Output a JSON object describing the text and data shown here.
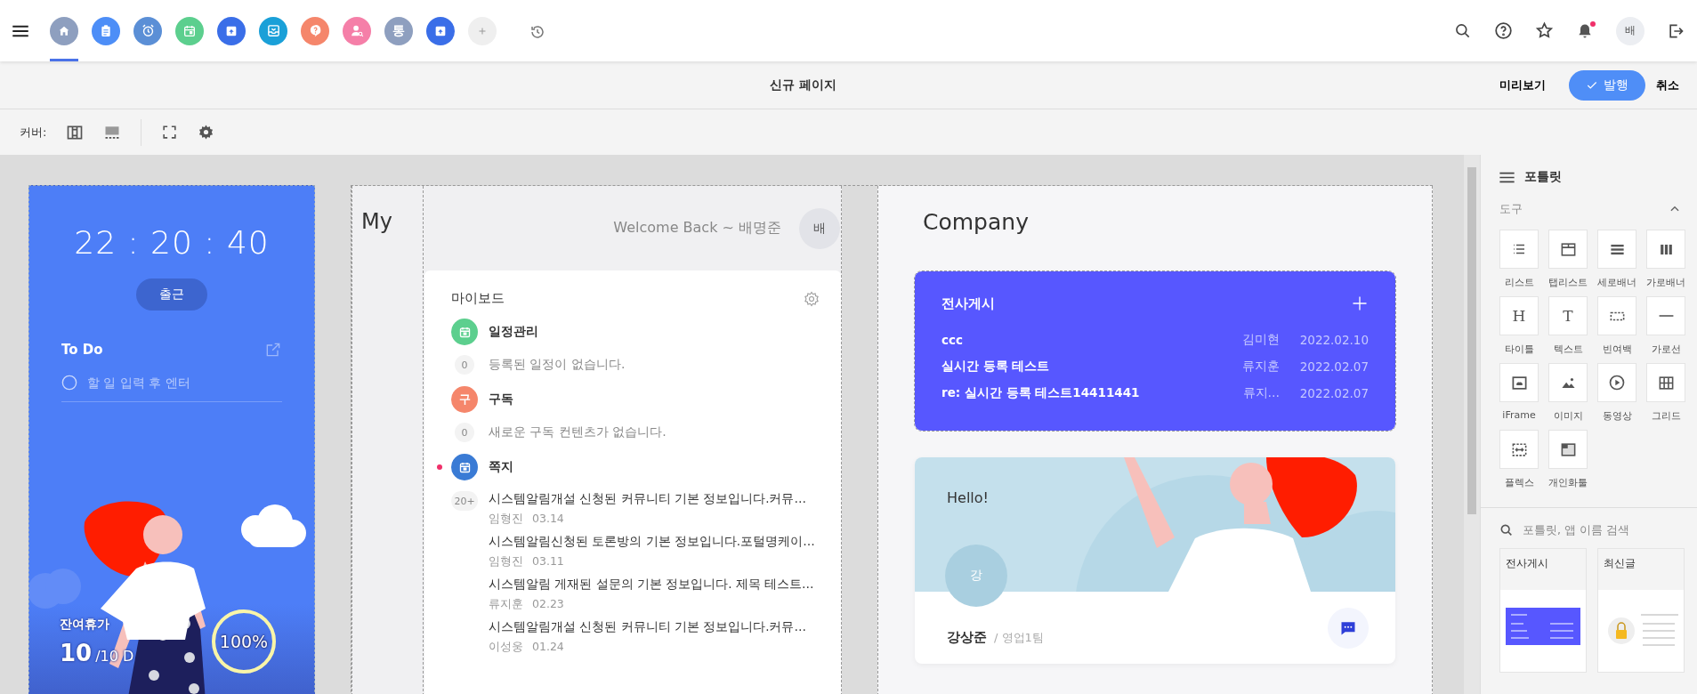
{
  "header": {
    "apps": [
      {
        "kind": "home",
        "color": "#8e9fbf",
        "selected": true
      },
      {
        "kind": "clipboard",
        "color": "#4d8ef7",
        "selected": false
      },
      {
        "kind": "alarm",
        "color": "#5b8fd6",
        "selected": false
      },
      {
        "kind": "calendar",
        "color": "#5ccf8e",
        "selected": false
      },
      {
        "kind": "archive",
        "color": "#3a6ee8",
        "selected": false
      },
      {
        "kind": "inbox",
        "color": "#1aa0d8",
        "selected": false
      },
      {
        "kind": "question",
        "color": "#f5866b",
        "selected": false
      },
      {
        "kind": "person-search",
        "color": "#f57fa8",
        "selected": false
      },
      {
        "kind": "text",
        "label": "통",
        "color": "#8e9fbf",
        "selected": false
      },
      {
        "kind": "archive",
        "color": "#3a6ee8",
        "selected": false
      },
      {
        "kind": "add",
        "color": "#efefef",
        "selected": false
      }
    ],
    "notification_unread": true,
    "avatar": "배"
  },
  "title_bar": {
    "title": "신규 페이지",
    "preview": "미리보기",
    "publish": "발행",
    "cancel": "취소"
  },
  "toolbar": {
    "cover_label": "커버:"
  },
  "time_card": {
    "clock": "22 : 20 : 40",
    "check_in": "출근",
    "todo_title": "To Do",
    "todo_placeholder": "할 일 입력 후 엔터",
    "leave_label": "잔여휴가",
    "leave_value": "10",
    "leave_total": "/10 D",
    "leave_percent": "100%",
    "level": 1
  },
  "my_column": {
    "title": "My",
    "welcome": "Welcome Back ~ 배명준",
    "avatar": "배"
  },
  "myboard": {
    "title": "마이보드",
    "sections": [
      {
        "kind": "calendar",
        "title": "일정관리",
        "color": "#5ccf8e",
        "unread": false,
        "count": "0",
        "empty": "등록된 일정이 없습니다."
      },
      {
        "kind": "text",
        "icon_text": "구",
        "title": "구독",
        "color": "#f5866b",
        "unread": false,
        "count": "0",
        "empty": "새로운 구독 컨텐츠가 없습니다."
      },
      {
        "kind": "calendar",
        "title": "쪽지",
        "color": "#3a7bd5",
        "unread": true,
        "count": "20+",
        "items": [
          {
            "text": "시스템알림개설 신청된 커뮤니티 기본 정보입니다.커뮤…",
            "author": "임형진",
            "date": "03.14"
          },
          {
            "text": "시스템알림신청된 토론방의 기본 정보입니다.포털명케이…",
            "author": "임형진",
            "date": "03.11"
          },
          {
            "text": "시스템알림 게재된 설문의 기본 정보입니다. 제목 테스트…",
            "author": "류지훈",
            "date": "02.23"
          },
          {
            "text": "시스템알림개설 신청된 커뮤니티 기본 정보입니다.커뮤…",
            "author": "이성웅",
            "date": "01.24"
          }
        ]
      }
    ]
  },
  "company": {
    "title": "Company",
    "board": {
      "title": "전사게시",
      "rows": [
        {
          "title": "ccc",
          "author": "김미현",
          "date": "2022.02.10"
        },
        {
          "title": "실시간 등록 테스트",
          "author": "류지훈",
          "date": "2022.02.07"
        },
        {
          "title": "re: 실시간 등록 테스트14411441",
          "author": "류지…",
          "date": "2022.02.07"
        }
      ]
    },
    "profile": {
      "greeting": "Hello!",
      "avatar": "강",
      "name": "강상준",
      "team": "/ 영업1팀"
    }
  },
  "sidebar": {
    "title": "포틀릿",
    "section": "도구",
    "expanded": true,
    "tools": [
      {
        "kind": "list",
        "label": "리스트"
      },
      {
        "kind": "tablist",
        "label": "탭리스트"
      },
      {
        "kind": "vbanner",
        "label": "세로배너"
      },
      {
        "kind": "hbanner",
        "label": "가로배너"
      },
      {
        "kind": "glyph",
        "glyph": "H",
        "label": "타이틀"
      },
      {
        "kind": "glyph",
        "glyph": "T",
        "label": "텍스트"
      },
      {
        "kind": "spacer",
        "label": "빈여백"
      },
      {
        "kind": "divider",
        "label": "가로선"
      },
      {
        "kind": "iframe",
        "label": "iFrame"
      },
      {
        "kind": "image",
        "label": "이미지"
      },
      {
        "kind": "video",
        "label": "동영상"
      },
      {
        "kind": "grid",
        "label": "그리드"
      },
      {
        "kind": "flex",
        "label": "플렉스"
      },
      {
        "kind": "personal",
        "label": "개인화툴"
      }
    ],
    "search_placeholder": "포틀릿, 앱 이름 검색",
    "previews": [
      {
        "kind": "board",
        "title": "전사게시"
      },
      {
        "kind": "latest",
        "title": "최신글"
      }
    ]
  }
}
